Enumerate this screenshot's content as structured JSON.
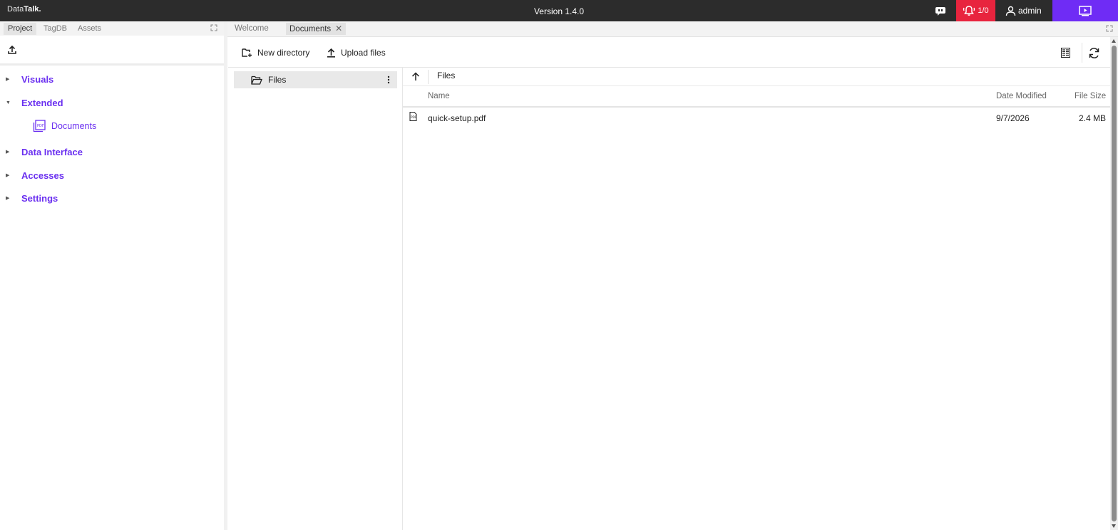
{
  "app": {
    "brand_prefix": "Data",
    "brand_bold": "Talk.",
    "version": "Version 1.4.0",
    "alarm_count": "1/0",
    "user": "admin"
  },
  "icons": {
    "chat": "chat-icon",
    "alarm": "bell-alert-icon",
    "user": "user-icon",
    "play": "play-window-icon",
    "upload": "upload-icon",
    "folder": "folder-open-icon",
    "pdf": "pdf-file-icon"
  },
  "colors": {
    "accent": "#6a2ff0",
    "topbar": "#2c2c2c",
    "alarm": "#e8243e",
    "play": "#6f2cf5"
  },
  "left_panel": {
    "tabs": [
      "Project",
      "TagDB",
      "Assets"
    ],
    "tree": [
      {
        "label": "Visuals",
        "expanded": false
      },
      {
        "label": "Extended",
        "expanded": true,
        "children": [
          "Documents"
        ]
      },
      {
        "label": "Data Interface",
        "expanded": false
      },
      {
        "label": "Accesses",
        "expanded": false
      },
      {
        "label": "Settings",
        "expanded": false
      }
    ]
  },
  "main": {
    "tabs": [
      {
        "label": "Welcome",
        "active": false
      },
      {
        "label": "Documents",
        "active": true,
        "close": "✕"
      }
    ],
    "toolbar": {
      "new_directory": "New directory",
      "upload_files": "Upload files"
    },
    "directory_tree": {
      "root": "Files"
    },
    "breadcrumb": "Files",
    "columns": {
      "name": "Name",
      "date_modified": "Date Modified",
      "file_size": "File Size"
    },
    "files": [
      {
        "name": "quick-setup.pdf",
        "date_modified": "9/7/2026",
        "file_size": "2.4 MB"
      }
    ]
  }
}
